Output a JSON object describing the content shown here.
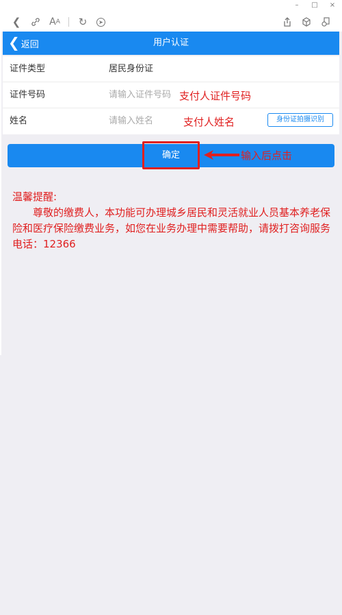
{
  "browser": {
    "window_controls": [
      "–",
      "□",
      "×"
    ]
  },
  "navbar": {
    "back_label": "返回",
    "title": "用户认证"
  },
  "form": {
    "id_type_label": "证件类型",
    "id_type_value": "居民身份证",
    "id_number_label": "证件号码",
    "id_number_placeholder": "请输入证件号码",
    "name_label": "姓名",
    "name_placeholder": "请输入姓名",
    "scan_button": "身份证拍摄识别"
  },
  "annotations": {
    "id_number_note": "支付人证件号码",
    "name_note": "支付人姓名",
    "click_note": "输入后点击"
  },
  "confirm_button": "确定",
  "tip": {
    "title": "温馨提醒:",
    "body": "尊敬的缴费人，本功能可办理城乡居民和灵活就业人员基本养老保险和医疗保险缴费业务，如您在业务办理中需要帮助，请拨打咨询服务电话：12366"
  },
  "colors": {
    "accent": "#1989f0",
    "annotation": "#e02020"
  }
}
